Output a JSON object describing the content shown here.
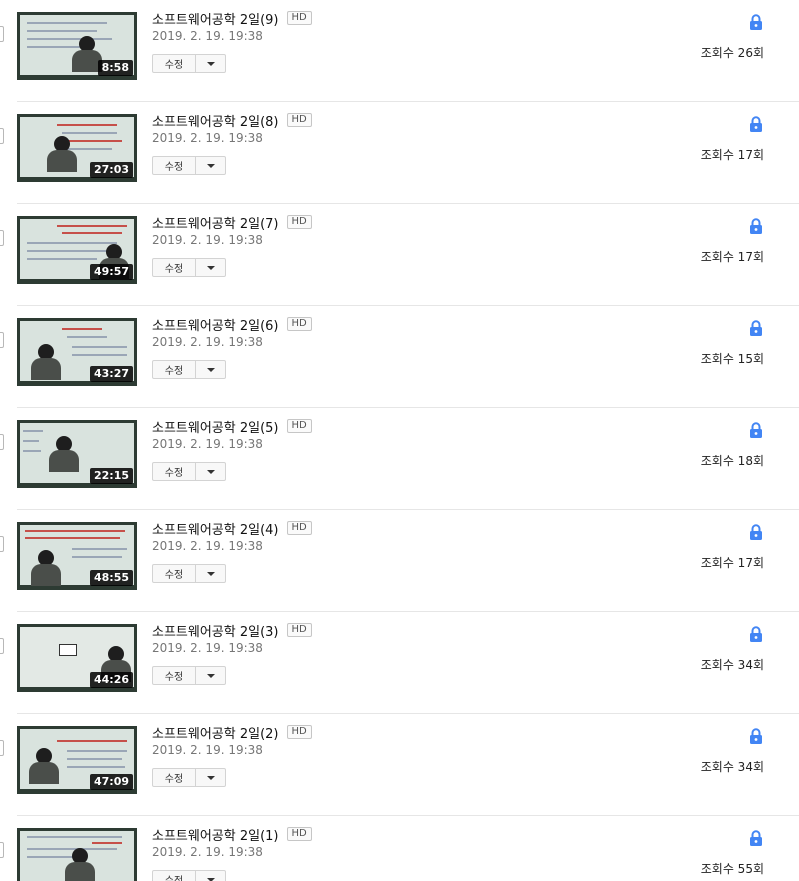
{
  "colors": {
    "lock": "#4285f4",
    "divider": "#e6e6e6",
    "date": "#767676"
  },
  "videos": [
    {
      "title": "소프트웨어공학 2일(9)",
      "hd": "HD",
      "date": "2019. 2. 19. 19:38",
      "duration": "8:58",
      "edit": "수정",
      "views": "조회수 26회",
      "privacy_icon": "lock-icon"
    },
    {
      "title": "소프트웨어공학 2일(8)",
      "hd": "HD",
      "date": "2019. 2. 19. 19:38",
      "duration": "27:03",
      "edit": "수정",
      "views": "조회수 17회",
      "privacy_icon": "lock-icon"
    },
    {
      "title": "소프트웨어공학 2일(7)",
      "hd": "HD",
      "date": "2019. 2. 19. 19:38",
      "duration": "49:57",
      "edit": "수정",
      "views": "조회수 17회",
      "privacy_icon": "lock-icon"
    },
    {
      "title": "소프트웨어공학 2일(6)",
      "hd": "HD",
      "date": "2019. 2. 19. 19:38",
      "duration": "43:27",
      "edit": "수정",
      "views": "조회수 15회",
      "privacy_icon": "lock-icon"
    },
    {
      "title": "소프트웨어공학 2일(5)",
      "hd": "HD",
      "date": "2019. 2. 19. 19:38",
      "duration": "22:15",
      "edit": "수정",
      "views": "조회수 18회",
      "privacy_icon": "lock-icon"
    },
    {
      "title": "소프트웨어공학 2일(4)",
      "hd": "HD",
      "date": "2019. 2. 19. 19:38",
      "duration": "48:55",
      "edit": "수정",
      "views": "조회수 17회",
      "privacy_icon": "lock-icon"
    },
    {
      "title": "소프트웨어공학 2일(3)",
      "hd": "HD",
      "date": "2019. 2. 19. 19:38",
      "duration": "44:26",
      "edit": "수정",
      "views": "조회수 34회",
      "privacy_icon": "lock-icon"
    },
    {
      "title": "소프트웨어공학 2일(2)",
      "hd": "HD",
      "date": "2019. 2. 19. 19:38",
      "duration": "47:09",
      "edit": "수정",
      "views": "조회수 34회",
      "privacy_icon": "lock-icon"
    },
    {
      "title": "소프트웨어공학 2일(1)",
      "hd": "HD",
      "date": "2019. 2. 19. 19:38",
      "duration": "",
      "edit": "수정",
      "views": "조회수 55회",
      "privacy_icon": "lock-icon"
    }
  ]
}
